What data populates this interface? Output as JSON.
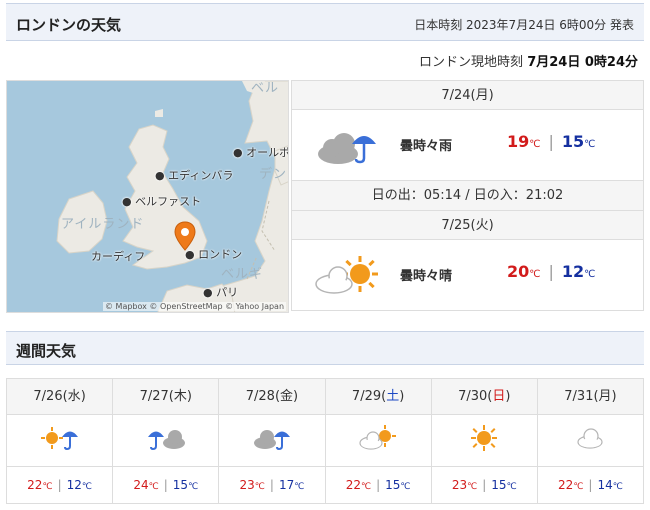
{
  "header": {
    "title": "ロンドンの天気",
    "issued": "日本時刻 2023年7月24日 6時00分 発表"
  },
  "local_time": {
    "label": "ロンドン現地時刻",
    "value": "7月24日 0時24分"
  },
  "map": {
    "labels": {
      "edinburgh": "エディンバラ",
      "belfast": "ベルファスト",
      "ireland": "アイルランド",
      "cardiff": "カーディフ",
      "london": "ロンドン",
      "paris": "パリ",
      "aalborg": "オールボー",
      "denmark": "デン",
      "belgium": "ベルギ",
      "norway": "ベル"
    },
    "attribution": "© Mapbox © OpenStreetMap © Yahoo Japan"
  },
  "today": {
    "date": "7/24(月)",
    "label": "曇時々雨",
    "icon": "cloud-umbrella-icon",
    "high": "19",
    "low": "15",
    "unit": "℃"
  },
  "sun": {
    "text": "日の出：05:14 / 日の入：21:02"
  },
  "tomorrow": {
    "date": "7/25(火)",
    "label": "曇時々晴",
    "icon": "cloud-sun-icon",
    "high": "20",
    "low": "12",
    "unit": "℃"
  },
  "weekly": {
    "title": "週間天気",
    "days": [
      {
        "prefix": "7/26(",
        "dow": "水",
        "suffix": ")",
        "dow_type": "weekday",
        "icon": "sun-umbrella-icon",
        "high": "22",
        "low": "12",
        "unit": "℃"
      },
      {
        "prefix": "7/27(",
        "dow": "木",
        "suffix": ")",
        "dow_type": "weekday",
        "icon": "umbrella-cloud-icon",
        "high": "24",
        "low": "15",
        "unit": "℃"
      },
      {
        "prefix": "7/28(",
        "dow": "金",
        "suffix": ")",
        "dow_type": "weekday",
        "icon": "cloud-umbrella-icon",
        "high": "23",
        "low": "17",
        "unit": "℃"
      },
      {
        "prefix": "7/29(",
        "dow": "土",
        "suffix": ")",
        "dow_type": "saturday",
        "icon": "cloud-sun-icon",
        "high": "22",
        "low": "15",
        "unit": "℃"
      },
      {
        "prefix": "7/30(",
        "dow": "日",
        "suffix": ")",
        "dow_type": "sunday",
        "icon": "sun-icon",
        "high": "23",
        "low": "15",
        "unit": "℃"
      },
      {
        "prefix": "7/31(",
        "dow": "月",
        "suffix": ")",
        "dow_type": "weekday",
        "icon": "cloud-icon",
        "high": "22",
        "low": "14",
        "unit": "℃"
      }
    ]
  },
  "colors": {
    "high": "#d21b1b",
    "low": "#1530a0",
    "sun": "#f29a1c",
    "umbrella": "#3a6fd8",
    "cloud": "#b5b5b5",
    "pin": "#ee7a1a"
  }
}
